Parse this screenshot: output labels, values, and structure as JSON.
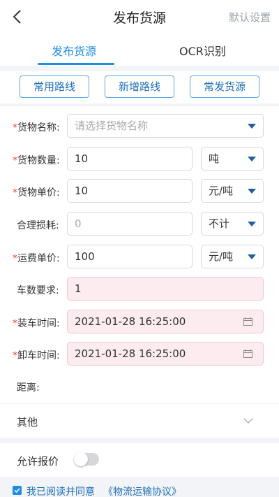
{
  "header": {
    "title": "发布货源",
    "settings_label": "默认设置"
  },
  "tabs": [
    {
      "label": "发布货源",
      "active": true
    },
    {
      "label": "OCR识别",
      "active": false
    }
  ],
  "route_buttons": [
    "常用路线",
    "新增路线",
    "常发货源"
  ],
  "form": {
    "goods_name": {
      "label": "货物名称:",
      "required": true,
      "placeholder": "请选择货物名称",
      "value": ""
    },
    "goods_quantity": {
      "label": "货物数量:",
      "required": true,
      "value": "10",
      "unit": "吨"
    },
    "goods_price": {
      "label": "货物单价:",
      "required": true,
      "value": "10",
      "unit": "元/吨"
    },
    "loss": {
      "label": "合理损耗:",
      "required": false,
      "placeholder": "0",
      "value": "",
      "unit": "不计"
    },
    "freight_price": {
      "label": "运费单价:",
      "required": true,
      "value": "100",
      "unit": "元/吨"
    },
    "vehicle_count": {
      "label": "车数要求:",
      "required": false,
      "value": "1"
    },
    "load_time": {
      "label": "装车时间:",
      "required": true,
      "value": "2021-01-28 16:25:00"
    },
    "unload_time": {
      "label": "卸车时间:",
      "required": true,
      "value": "2021-01-28 16:25:00"
    },
    "distance": {
      "label": "距离:",
      "value": ""
    }
  },
  "other": {
    "label": "其他"
  },
  "allow_quote": {
    "label": "允许报价",
    "enabled": false
  },
  "agreement": {
    "text": "我已阅读并同意",
    "link": "《物流运输协议》",
    "checked": true
  },
  "colors": {
    "accent": "#1f8ce6",
    "required_star": "#e0413a",
    "highlight_field": "#fdecef"
  },
  "icons": {
    "back": "chevron-left-icon",
    "dropdown": "caret-down-icon",
    "calendar": "calendar-icon",
    "expand": "chevron-down-icon",
    "checkbox": "checkbox-checked-icon"
  }
}
